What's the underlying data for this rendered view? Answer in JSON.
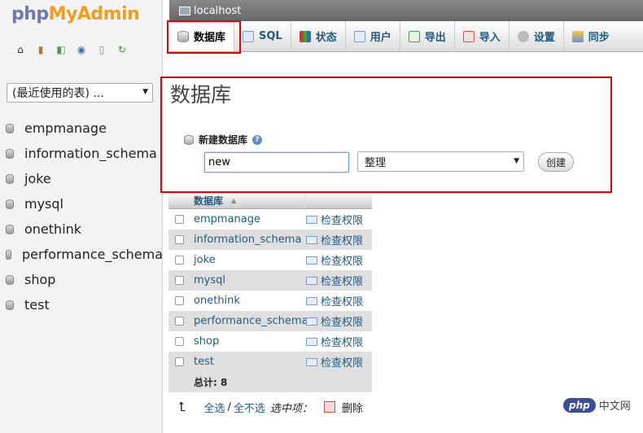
{
  "sidebar": {
    "logo_php": "php",
    "logo_myadmin": "MyAdmin",
    "nav_icons": [
      "home-icon",
      "exit-icon",
      "sql-query-icon",
      "docs-icon",
      "docs-page-icon",
      "reload-icon"
    ],
    "recent_select": "(最近使用的表) ...",
    "databases": [
      "empmanage",
      "information_schema",
      "joke",
      "mysql",
      "onethink",
      "performance_schema",
      "shop",
      "test"
    ]
  },
  "server": {
    "name": "localhost"
  },
  "tabs": [
    {
      "label": "数据库",
      "icon": "database-icon",
      "active": true
    },
    {
      "label": "SQL",
      "icon": "sql-icon"
    },
    {
      "label": "状态",
      "icon": "status-icon"
    },
    {
      "label": "用户",
      "icon": "users-icon"
    },
    {
      "label": "导出",
      "icon": "export-icon"
    },
    {
      "label": "导入",
      "icon": "import-icon"
    },
    {
      "label": "设置",
      "icon": "settings-icon"
    },
    {
      "label": "同步",
      "icon": "sync-icon"
    }
  ],
  "main": {
    "title": "数据库",
    "create_label": "新建数据库",
    "new_db_value": "new",
    "collation": "整理",
    "create_button": "创建"
  },
  "table": {
    "header": "数据库",
    "check_privileges": "检查权限",
    "rows": [
      "empmanage",
      "information_schema",
      "joke",
      "mysql",
      "onethink",
      "performance_schema",
      "shop",
      "test"
    ],
    "total": "总计: 8"
  },
  "bulk": {
    "check_all": "全选",
    "separator": "/",
    "uncheck_all": "全不选",
    "with_selected": "选中项：",
    "delete": "删除"
  },
  "watermark": {
    "badge": "php",
    "text": "中文网"
  },
  "colors": {
    "highlight": "#ee0000",
    "link": "#235a81",
    "logo_php": "#6c78af",
    "logo_myadmin": "#f29d1e"
  }
}
